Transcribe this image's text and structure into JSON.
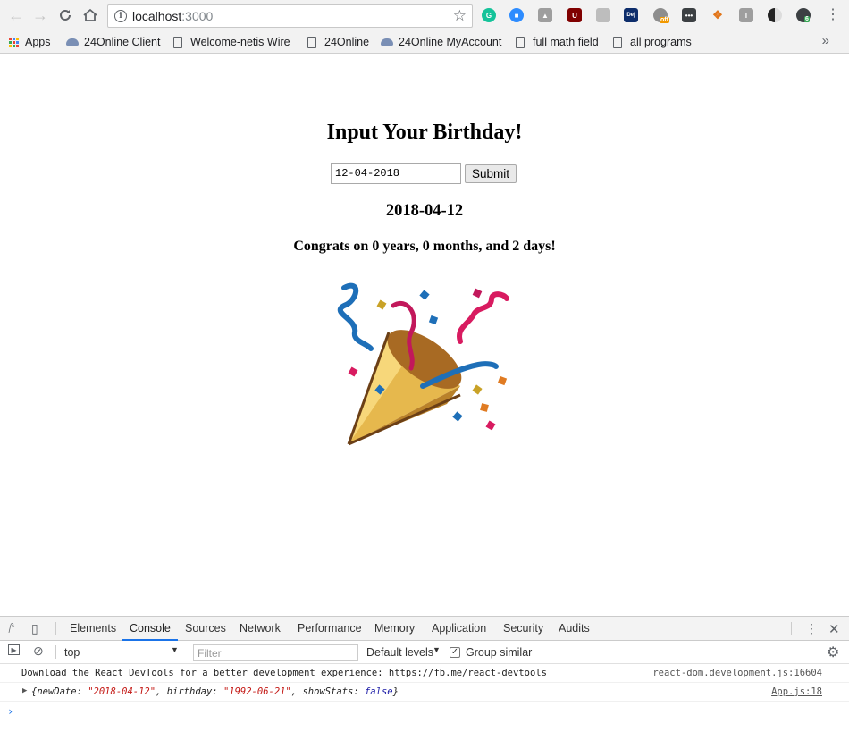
{
  "browser": {
    "url_host": "localhost",
    "url_port": ":3000",
    "bookmarks": [
      {
        "label": "Apps"
      },
      {
        "label": "24Online Client"
      },
      {
        "label": "Welcome-netis Wirel"
      },
      {
        "label": "24Online"
      },
      {
        "label": "24Online MyAccount"
      },
      {
        "label": "full math field"
      },
      {
        "label": "all programs"
      }
    ],
    "bookmarks_more": "»",
    "extensions": [
      "grammarly-icon",
      "zoom-icon",
      "drive-icon",
      "ublock-icon",
      "trello-icon",
      "dejavu-icon",
      "proxy-icon",
      "dots-icon",
      "metamask-icon",
      "text-icon",
      "dark-mode-icon",
      "user-icon"
    ],
    "ext_badge_off": "off",
    "ext_badge_count": "6"
  },
  "page": {
    "heading": "Input Your Birthday!",
    "date_value": "12-04-2018",
    "submit_label": "Submit",
    "output_date": "2018-04-12",
    "congrats": "Congrats on 0 years, 0 months, and 2 days!"
  },
  "devtools": {
    "tabs": [
      "Elements",
      "Console",
      "Sources",
      "Network",
      "Performance",
      "Memory",
      "Application",
      "Security",
      "Audits"
    ],
    "active_tab": "Console",
    "context": "top",
    "filter_placeholder": "Filter",
    "levels": "Default levels",
    "group_similar": "Group similar",
    "logs": [
      {
        "text": "Download the React DevTools for a better development experience: ",
        "link": "https://fb.me/react-devtools",
        "source": "react-dom.development.js:16604"
      },
      {
        "prefix": "{newDate: ",
        "new_date": "\"2018-04-12\"",
        "mid1": ", birthday: ",
        "birthday": "\"1992-06-21\"",
        "mid2": ", showStats: ",
        "show_stats": "false",
        "suffix": "}",
        "source": "App.js:18"
      }
    ],
    "prompt": "›"
  }
}
